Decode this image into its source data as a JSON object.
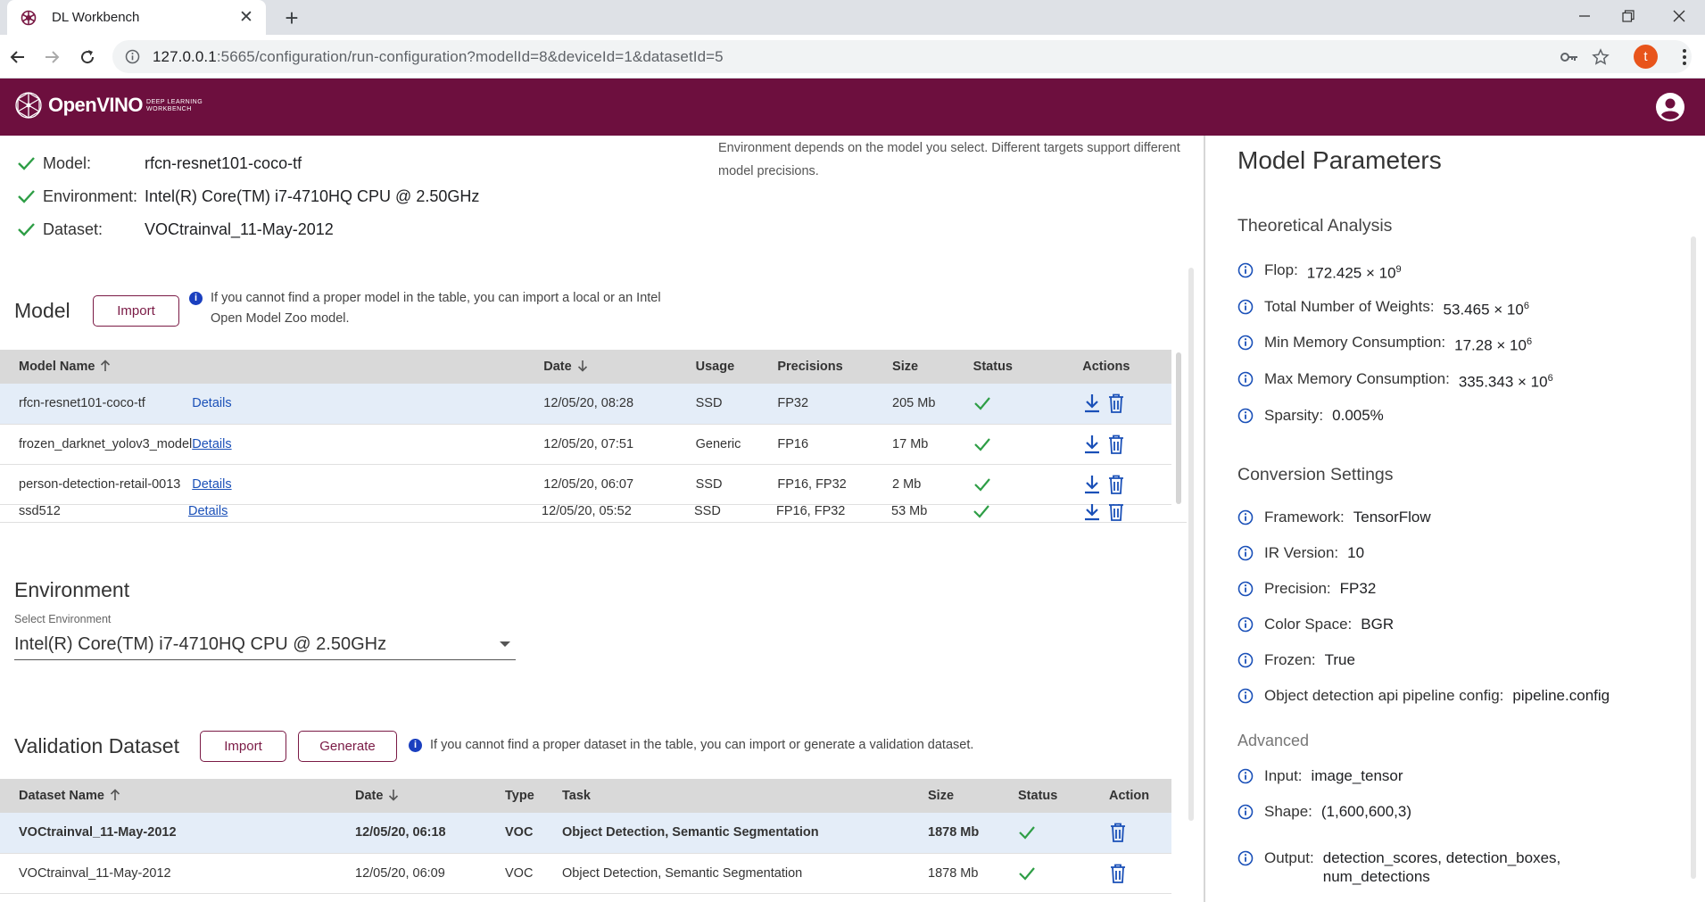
{
  "browser": {
    "tab_title": "DL Workbench",
    "url_host": "127.0.0.1",
    "url_rest": ":5665/configuration/run-configuration?modelId=8&deviceId=1&datasetId=5",
    "profile_initial": "t"
  },
  "app": {
    "brand": "OpenVINO",
    "brand_sub_1": "DEEP LEARNING",
    "brand_sub_2": "WORKBENCH"
  },
  "summary": {
    "model_label": "Model:",
    "model_value": "rfcn-resnet101-coco-tf",
    "env_label": "Environment:",
    "env_value": "Intel(R) Core(TM) i7-4710HQ CPU @ 2.50GHz",
    "dataset_label": "Dataset:",
    "dataset_value": "VOCtrainval_11-May-2012",
    "env_note": "Environment depends on the model you select. Different targets support different model precisions."
  },
  "model_section": {
    "title": "Model",
    "import_label": "Import",
    "info_line1": "If you cannot find a proper model in the table, you can import a local or an Intel",
    "info_line2": "Open Model Zoo model.",
    "columns": [
      "Model Name",
      "Date",
      "Usage",
      "Precisions",
      "Size",
      "Status",
      "Actions"
    ],
    "rows": [
      {
        "name": "rfcn-resnet101-coco-tf",
        "details": "Details",
        "date": "12/05/20, 08:28",
        "usage": "SSD",
        "precisions": "FP32",
        "size": "205 Mb"
      },
      {
        "name": "frozen_darknet_yolov3_model",
        "details": "Details",
        "date": "12/05/20, 07:51",
        "usage": "Generic",
        "precisions": "FP16",
        "size": "17 Mb"
      },
      {
        "name": "person-detection-retail-0013",
        "details": "Details",
        "date": "12/05/20, 06:07",
        "usage": "SSD",
        "precisions": "FP16, FP32",
        "size": "2 Mb"
      },
      {
        "name": "ssd512",
        "details": "Details",
        "date": "12/05/20, 05:52",
        "usage": "SSD",
        "precisions": "FP16, FP32",
        "size": "53 Mb"
      }
    ]
  },
  "environment_section": {
    "title": "Environment",
    "select_label": "Select Environment",
    "select_value": "Intel(R) Core(TM) i7-4710HQ CPU @ 2.50GHz"
  },
  "dataset_section": {
    "title": "Validation Dataset",
    "import_label": "Import",
    "generate_label": "Generate",
    "info": "If you cannot find a proper dataset in the table, you can import or generate a validation dataset.",
    "columns": [
      "Dataset Name",
      "Date",
      "Type",
      "Task",
      "Size",
      "Status",
      "Action"
    ],
    "rows": [
      {
        "name": "VOCtrainval_11-May-2012",
        "date": "12/05/20, 06:18",
        "type": "VOC",
        "task": "Object Detection, Semantic Segmentation",
        "size": "1878 Mb"
      },
      {
        "name": "VOCtrainval_11-May-2012",
        "date": "12/05/20, 06:09",
        "type": "VOC",
        "task": "Object Detection, Semantic Segmentation",
        "size": "1878 Mb"
      }
    ]
  },
  "params": {
    "title": "Model Parameters",
    "theoretical_title": "Theoretical Analysis",
    "flop_label": "Flop:",
    "flop_value": "172.425 × 10",
    "flop_exp": "9",
    "weights_label": "Total Number of Weights:",
    "weights_value": "53.465 × 10",
    "weights_exp": "6",
    "minmem_label": "Min Memory Consumption:",
    "minmem_value": "17.28 × 10",
    "minmem_exp": "6",
    "maxmem_label": "Max Memory Consumption:",
    "maxmem_value": "335.343 × 10",
    "maxmem_exp": "6",
    "sparsity_label": "Sparsity:",
    "sparsity_value": "0.005%",
    "conversion_title": "Conversion Settings",
    "framework_label": "Framework:",
    "framework_value": "TensorFlow",
    "ir_label": "IR Version:",
    "ir_value": "10",
    "precision_label": "Precision:",
    "precision_value": "FP32",
    "color_label": "Color Space:",
    "color_value": "BGR",
    "frozen_label": "Frozen:",
    "frozen_value": "True",
    "pipeline_label": "Object detection api pipeline config:",
    "pipeline_value": "pipeline.config",
    "advanced_title": "Advanced",
    "input_label": "Input:",
    "input_value": "image_tensor",
    "shape_label": "Shape:",
    "shape_value": "(1,600,600,3)",
    "output_label": "Output:",
    "output_value": "detection_scores, detection_boxes, num_detections"
  },
  "colors": {
    "brand": "#6d0f3e",
    "accent_button": "#7a1a45",
    "link": "#1a50b8",
    "status_ok": "#2e9e46",
    "selected_row": "#e4edf8"
  }
}
